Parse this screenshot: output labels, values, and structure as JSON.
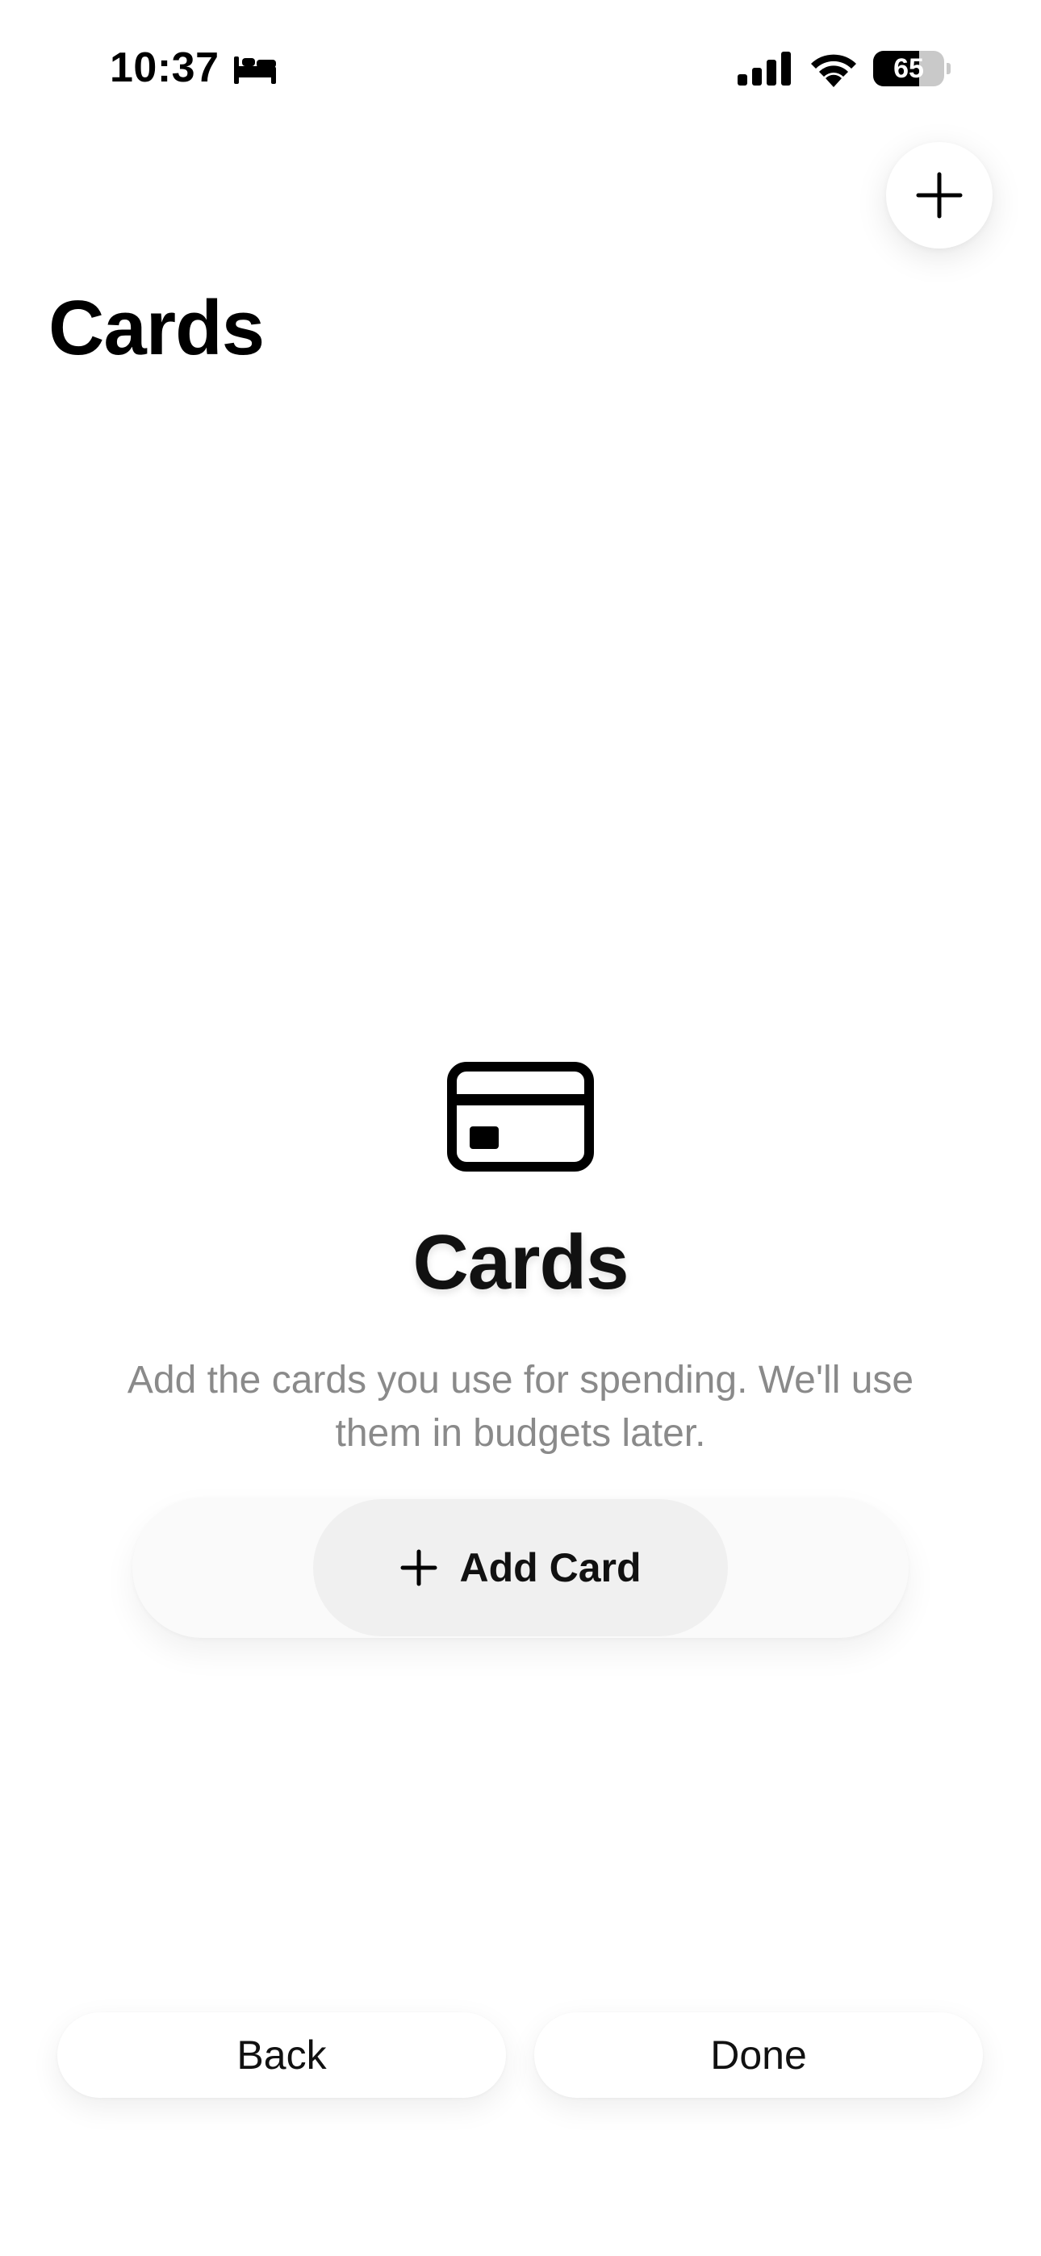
{
  "status_bar": {
    "time": "10:37",
    "battery_percent": "65",
    "battery_level": 0.65,
    "icons": [
      "bed-icon",
      "cellular-signal-icon",
      "wifi-icon",
      "battery-icon"
    ]
  },
  "header": {
    "title": "Cards",
    "add_icon": "plus-icon"
  },
  "empty_state": {
    "icon": "credit-card-icon",
    "title": "Cards",
    "description": "Add the cards you use for spending. We'll use them in budgets later.",
    "add_button_label": "Add Card",
    "add_button_icon": "plus-icon"
  },
  "footer": {
    "back_label": "Back",
    "done_label": "Done"
  },
  "colors": {
    "background": "#ffffff",
    "text_primary": "#111111",
    "text_secondary": "#8a8a8a",
    "button_fill": "#f0f0f0"
  }
}
